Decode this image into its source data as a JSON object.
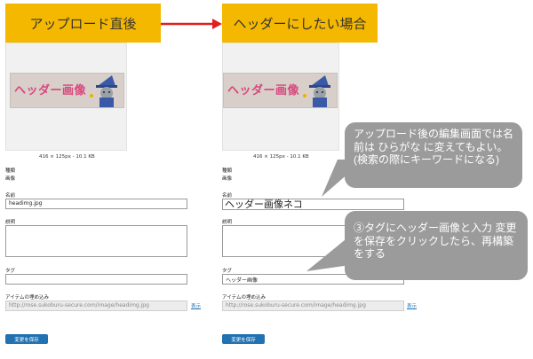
{
  "banners": {
    "left": "アップロード直後",
    "right": "ヘッダーにしたい場合"
  },
  "colors": {
    "banner": "#f5b800",
    "arrow": "#e02020",
    "callout": "#9b9b9b",
    "button": "#2271b1"
  },
  "left_panel": {
    "image_text": "ヘッダー画像",
    "meta": "416 × 125px - 10.1 KB",
    "type_label": "種類",
    "type_value": "画像",
    "name_label": "名前",
    "name_value": "headimg.jpg",
    "desc_label": "説明",
    "tag_label": "タグ",
    "tag_value": "",
    "embed_label": "アイテムの埋め込み",
    "embed_value": "http://rose.sukoburu-secure.com/image/headimg.jpg",
    "view_link": "表示",
    "save_button": "変更を保存"
  },
  "right_panel": {
    "image_text": "ヘッダー画像",
    "meta": "416 × 125px - 10.1 KB",
    "type_label": "種類",
    "type_value": "画像",
    "name_label": "名前",
    "name_value": "ヘッダー画像ネコ",
    "desc_label": "説明",
    "tag_label": "タグ",
    "tag_value": "ヘッダー画像",
    "embed_label": "アイテムの埋め込み",
    "embed_value": "http://rose.sukoburu-secure.com/image/headimg.jpg",
    "view_link": "表示",
    "save_button": "変更を保存"
  },
  "callouts": {
    "first": "アップロード後の編集画面では名前は ひらがな に変えてもよい。(検索の際にキーワードになる)",
    "second": "③タグにヘッダー画像と入力 変更を保存をクリックしたら、再構築をする"
  }
}
